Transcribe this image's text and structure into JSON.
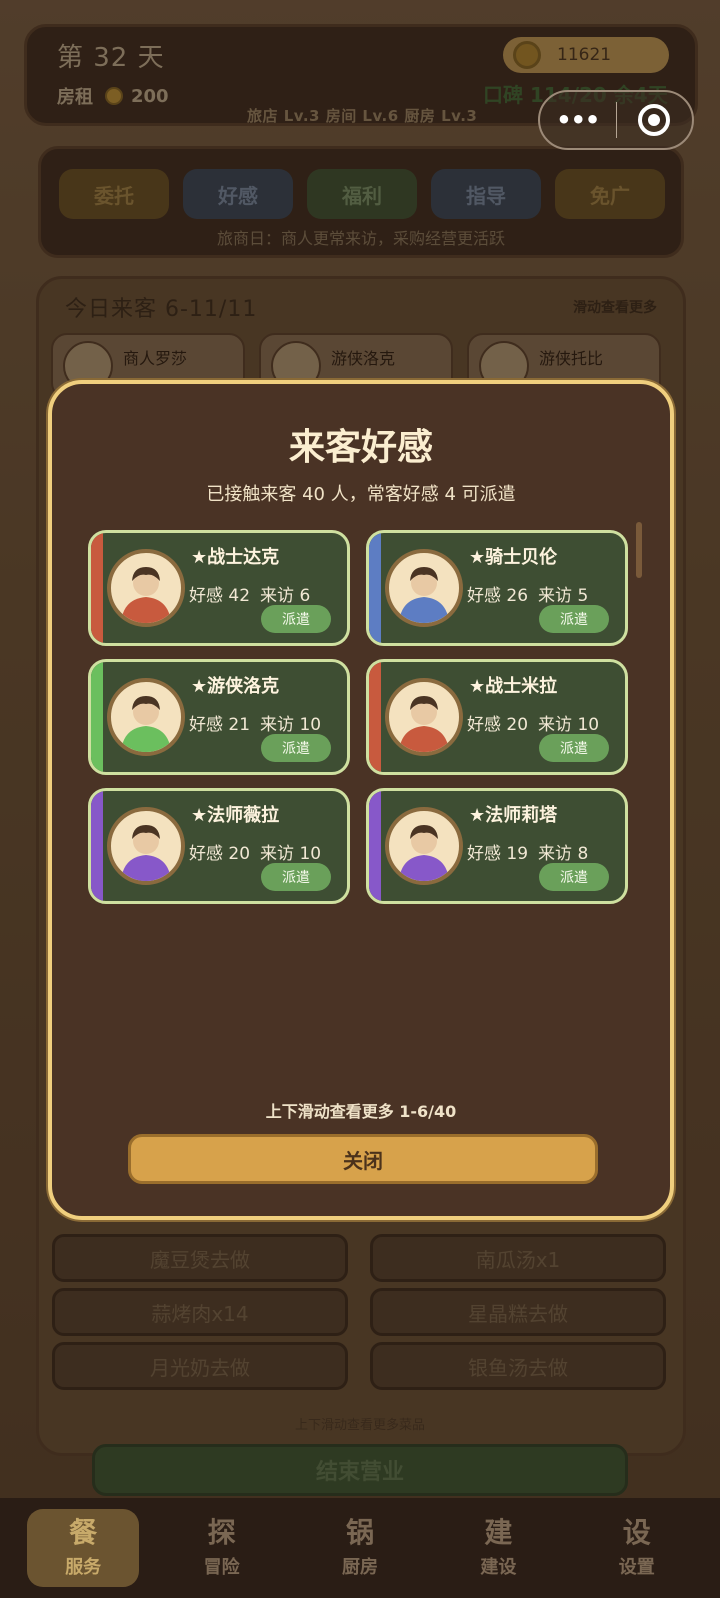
{
  "status": {
    "day": "第 32 天",
    "rent_label": "房租",
    "rent_value": "200",
    "coins": "11621",
    "reputation": "口碑 114/20 余4天",
    "levels": "旅店 Lv.3  房间 Lv.6  厨房 Lv.3"
  },
  "capsule": {
    "more": "•••"
  },
  "tabs": {
    "items": [
      {
        "label": "委托"
      },
      {
        "label": "好感"
      },
      {
        "label": "福利"
      },
      {
        "label": "指导"
      },
      {
        "label": "免广"
      }
    ],
    "note": "旅商日：商人更常来访，采购经营更活跃"
  },
  "guests": {
    "title": "今日来客 6-11/11",
    "hint": "滑动查看更多",
    "cards": [
      {
        "name": "商人罗莎"
      },
      {
        "name": "游侠洛克"
      },
      {
        "name": "游侠托比"
      }
    ]
  },
  "dishes": [
    {
      "label": "魔豆煲去做"
    },
    {
      "label": "南瓜汤x1"
    },
    {
      "label": "蒜烤肉x14"
    },
    {
      "label": "星晶糕去做"
    },
    {
      "label": "月光奶去做"
    },
    {
      "label": "银鱼汤去做"
    }
  ],
  "dish_hint": "上下滑动查看更多菜品",
  "end_label": "结束营业",
  "nav": [
    {
      "icon": "餐",
      "label": "服务"
    },
    {
      "icon": "探",
      "label": "冒险"
    },
    {
      "icon": "锅",
      "label": "厨房"
    },
    {
      "icon": "建",
      "label": "建设"
    },
    {
      "icon": "设",
      "label": "设置"
    }
  ],
  "modal": {
    "title": "来客好感",
    "subtitle": "已接触来客 40 人，常客好感 4 可派遣",
    "footer": "上下滑动查看更多  1-6/40",
    "close_label": "关闭",
    "cards": [
      {
        "name": "★战士达克",
        "affinity": "好感 42",
        "visits": "来访 6",
        "action": "派遣",
        "stripe": "#c85a3e",
        "class_icon": "warrior-portrait-icon"
      },
      {
        "name": "★骑士贝伦",
        "affinity": "好感 26",
        "visits": "来访 5",
        "action": "派遣",
        "stripe": "#5d7dc3",
        "class_icon": "knight-portrait-icon"
      },
      {
        "name": "★游侠洛克",
        "affinity": "好感 21",
        "visits": "来访 10",
        "action": "派遣",
        "stripe": "#6bbf5e",
        "class_icon": "ranger-portrait-icon"
      },
      {
        "name": "★战士米拉",
        "affinity": "好感 20",
        "visits": "来访 10",
        "action": "派遣",
        "stripe": "#c85a3e",
        "class_icon": "warrior-portrait-icon"
      },
      {
        "name": "★法师薇拉",
        "affinity": "好感 20",
        "visits": "来访 10",
        "action": "派遣",
        "stripe": "#8758c9",
        "class_icon": "mage-portrait-icon"
      },
      {
        "name": "★法师莉塔",
        "affinity": "好感 19",
        "visits": "来访 8",
        "action": "派遣",
        "stripe": "#8758c9",
        "class_icon": "mage-portrait-icon"
      }
    ]
  },
  "colors": {
    "modal_border": "#f0cf7e",
    "card_bg": "#3e4e33",
    "dispatch_button": "#6aa05a",
    "close_button": "#d7a24b"
  }
}
